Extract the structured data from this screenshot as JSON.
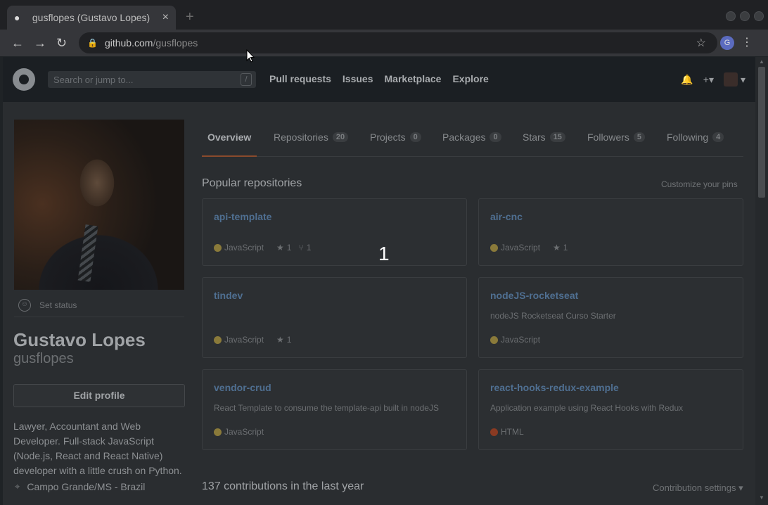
{
  "browser": {
    "tab_title": "gusflopes (Gustavo Lopes)",
    "tab_close": "×",
    "new_tab": "+",
    "url_host": "github.com",
    "url_path": "/gusflopes",
    "profile_initial": "G",
    "back": "←",
    "forward": "→",
    "reload": "↻",
    "star": "☆",
    "menu": "⋮"
  },
  "header": {
    "search_placeholder": "Search or jump to...",
    "search_key": "/",
    "nav": [
      "Pull requests",
      "Issues",
      "Marketplace",
      "Explore"
    ],
    "bell": "🔔",
    "plus": "+▾",
    "avatar_caret": "▾"
  },
  "profile": {
    "set_status": "Set status",
    "name": "Gustavo Lopes",
    "login": "gusflopes",
    "edit_profile": "Edit profile",
    "bio": "Lawyer, Accountant and Web Developer. Full-stack JavaScript (Node.js, React and React Native) developer with a little crush on Python.",
    "location": "Campo Grande/MS - Brazil"
  },
  "tabs": [
    {
      "label": "Overview",
      "count": ""
    },
    {
      "label": "Repositories",
      "count": "20"
    },
    {
      "label": "Projects",
      "count": "0"
    },
    {
      "label": "Packages",
      "count": "0"
    },
    {
      "label": "Stars",
      "count": "15"
    },
    {
      "label": "Followers",
      "count": "5"
    },
    {
      "label": "Following",
      "count": "4"
    }
  ],
  "popular": {
    "title": "Popular repositories",
    "customize": "Customize your pins",
    "repos": [
      {
        "name": "api-template",
        "desc": "",
        "lang": "JavaScript",
        "lang_color": "#8a7a3a",
        "stars": "1",
        "forks": "1"
      },
      {
        "name": "air-cnc",
        "desc": "",
        "lang": "JavaScript",
        "lang_color": "#8a7a3a",
        "stars": "1",
        "forks": ""
      },
      {
        "name": "tindev",
        "desc": "",
        "lang": "JavaScript",
        "lang_color": "#8a7a3a",
        "stars": "1",
        "forks": ""
      },
      {
        "name": "nodeJS-rocketseat",
        "desc": "nodeJS Rocketseat Curso Starter",
        "lang": "JavaScript",
        "lang_color": "#8a7a3a",
        "stars": "",
        "forks": ""
      },
      {
        "name": "vendor-crud",
        "desc": "React Template to consume the template-api built in nodeJS",
        "lang": "JavaScript",
        "lang_color": "#8a7a3a",
        "stars": "",
        "forks": ""
      },
      {
        "name": "react-hooks-redux-example",
        "desc": "Application example using React Hooks with Redux",
        "lang": "HTML",
        "lang_color": "#8a3a22",
        "stars": "",
        "forks": ""
      }
    ]
  },
  "contributions": {
    "title": "137 contributions in the last year",
    "settings": "Contribution settings ▾"
  },
  "overlay_number": "1"
}
